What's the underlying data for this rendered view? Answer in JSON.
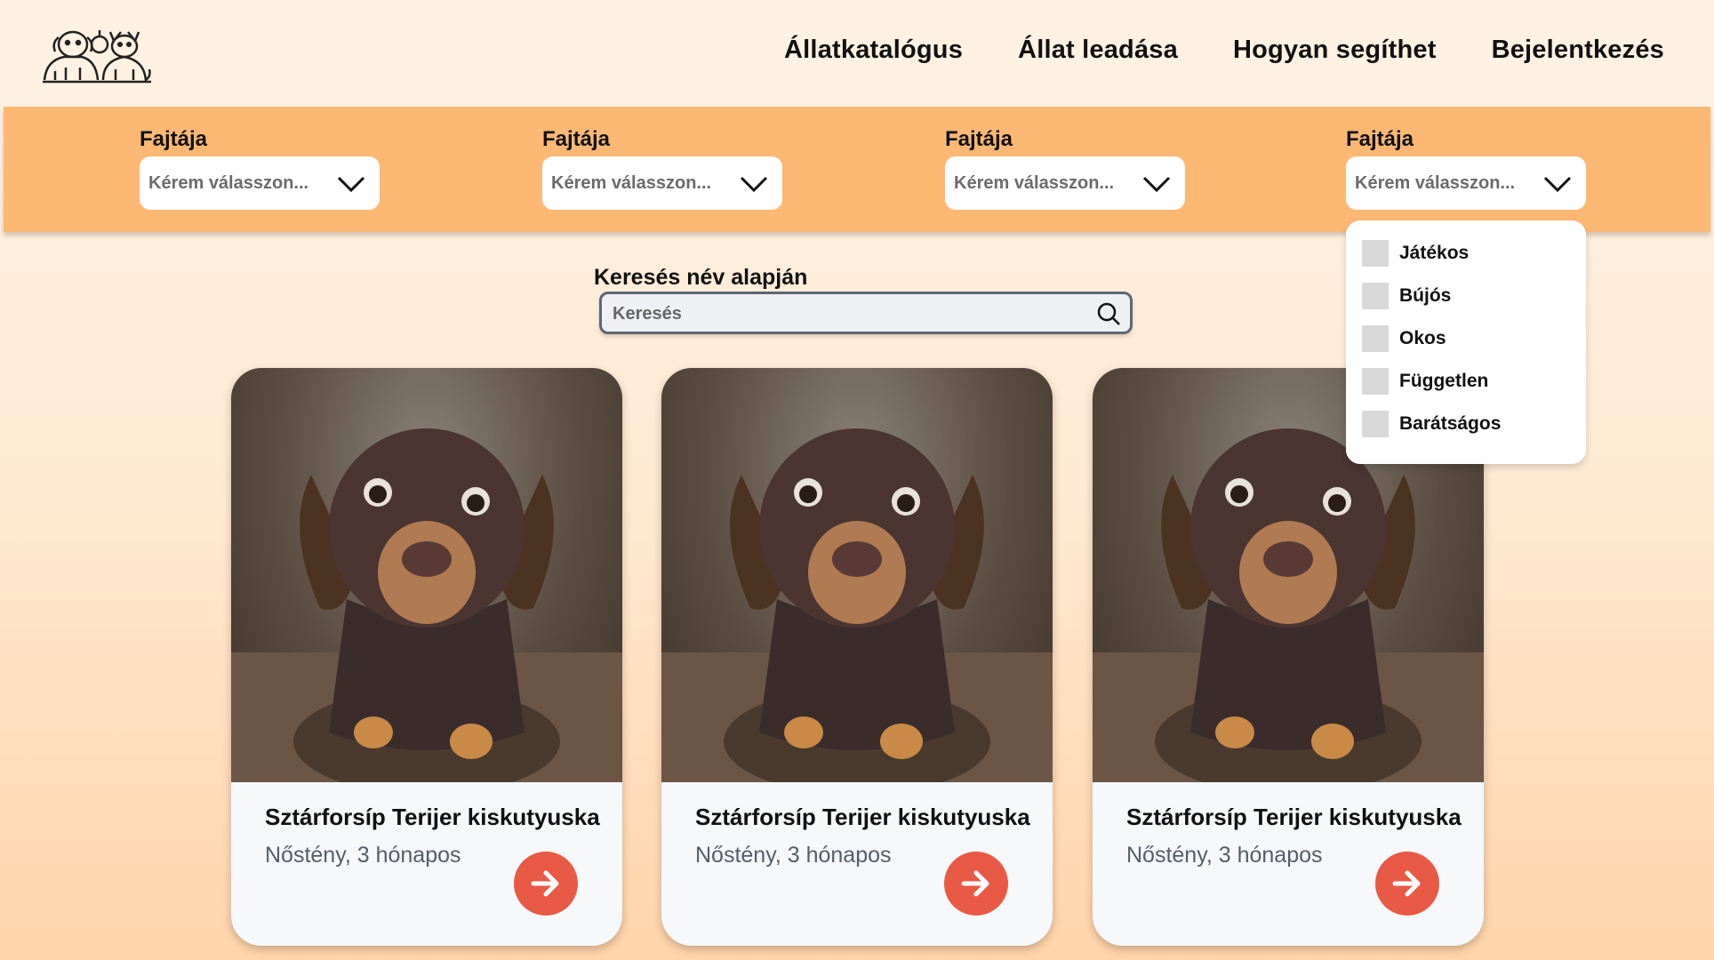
{
  "nav": {
    "items": [
      "Állatkatalógus",
      "Állat leadása",
      "Hogyan segíthet",
      "Bejelentkezés"
    ]
  },
  "filters": [
    {
      "label": "Fajtája",
      "placeholder": "Kérem válasszon..."
    },
    {
      "label": "Fajtája",
      "placeholder": "Kérem válasszon..."
    },
    {
      "label": "Fajtája",
      "placeholder": "Kérem válasszon..."
    },
    {
      "label": "Fajtája",
      "placeholder": "Kérem válasszon..."
    }
  ],
  "dropdown": {
    "options": [
      "Játékos",
      "Bújós",
      "Okos",
      "Független",
      "Barátságos"
    ]
  },
  "search": {
    "label": "Keresés név alapján",
    "placeholder": "Keresés"
  },
  "cards": [
    {
      "title": "Sztárforsíp Terijer kiskutyuska",
      "subtitle": "Nőstény, 3 hónapos"
    },
    {
      "title": "Sztárforsíp Terijer kiskutyuska",
      "subtitle": "Nőstény, 3 hónapos"
    },
    {
      "title": "Sztárforsíp Terijer kiskutyuska",
      "subtitle": "Nőstény, 3 hónapos"
    }
  ],
  "colors": {
    "filterbar": "#fdb874",
    "header": "#fff2e3",
    "accent_button": "#e85a45"
  },
  "icons": [
    "logo-pets-icon",
    "chevron-down-icon",
    "search-icon",
    "arrow-right-icon",
    "checkbox-icon"
  ]
}
